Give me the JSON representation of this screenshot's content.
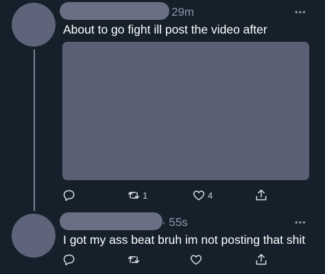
{
  "thread": {
    "tweets": [
      {
        "time": "29m",
        "text": "About to go fight ill post the video after",
        "actions": {
          "reply_count": "",
          "retweet_count": "1",
          "like_count": "4"
        }
      },
      {
        "time": "· 55s",
        "text": "I got my ass beat bruh im not posting that shit",
        "actions": {
          "reply_count": "",
          "retweet_count": "",
          "like_count": ""
        }
      }
    ]
  },
  "icons": {
    "reply": "reply-icon",
    "retweet": "retweet-icon",
    "like": "heart-icon",
    "share": "share-icon",
    "more": "more-icon"
  },
  "colors": {
    "background": "#15202b",
    "avatar": "#5e6479",
    "media": "#5a5f74",
    "muted_text": "#8b98a5"
  }
}
